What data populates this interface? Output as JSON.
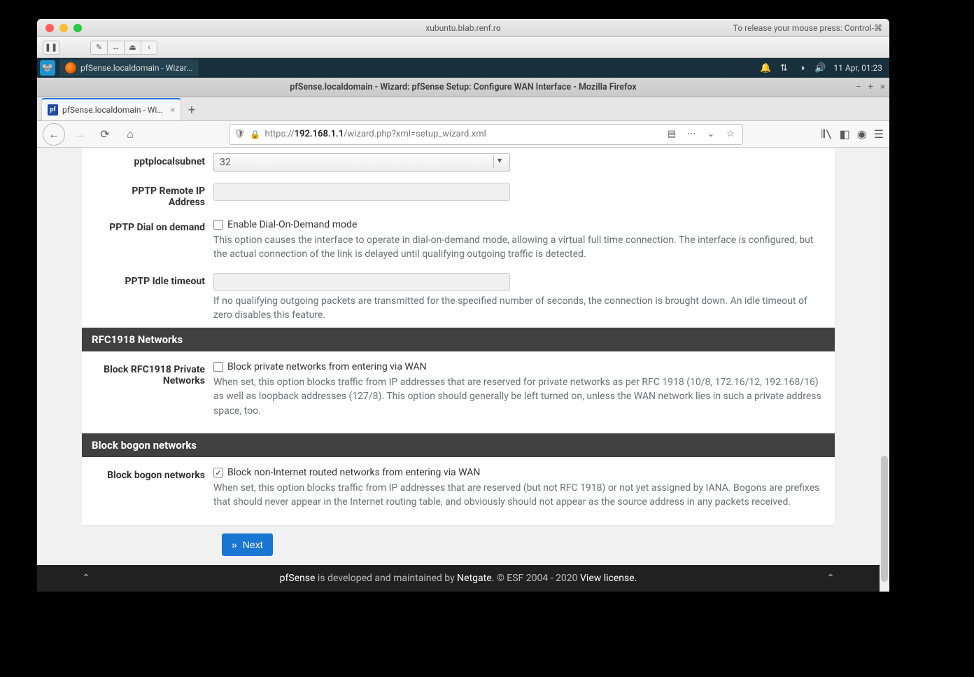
{
  "host": {
    "title": "xubuntu.blab.renf.ro",
    "release_hint": "To release your mouse press: Control-⌘"
  },
  "xfce": {
    "task_label": "pfSense.localdomain - Wizar...",
    "clock": "11 Apr, 01:23"
  },
  "firefox": {
    "window_title": "pfSense.localdomain - Wizard: pfSense Setup: Configure WAN Interface - Mozilla Firefox",
    "tab_label": "pfSense.localdomain - Wizard",
    "url_prefix": "https://",
    "url_host": "192.168.1.1",
    "url_path": "/wizard.php?xml=setup_wizard.xml"
  },
  "form": {
    "pptplocalsubnet": {
      "label": "pptplocalsubnet",
      "value": "32"
    },
    "pptp_remote_ip": {
      "label": "PPTP Remote IP Address",
      "value": ""
    },
    "pptp_dial": {
      "label": "PPTP Dial on demand",
      "checkbox_label": "Enable Dial-On-Demand mode",
      "checked": false,
      "help": "This option causes the interface to operate in dial-on-demand mode, allowing a virtual full time connection. The interface is configured, but the actual connection of the link is delayed until qualifying outgoing traffic is detected."
    },
    "pptp_idle": {
      "label": "PPTP Idle timeout",
      "value": "",
      "help": "If no qualifying outgoing packets are transmitted for the specified number of seconds, the connection is brought down. An idle timeout of zero disables this feature."
    }
  },
  "panels": {
    "rfc1918": {
      "title": "RFC1918 Networks",
      "field_label": "Block RFC1918 Private Networks",
      "checkbox_label": "Block private networks from entering via WAN",
      "checked": false,
      "help": "When set, this option blocks traffic from IP addresses that are reserved for private networks as per RFC 1918 (10/8, 172.16/12, 192.168/16) as well as loopback addresses (127/8). This option should generally be left turned on, unless the WAN network lies in such a private address space, too."
    },
    "bogon": {
      "title": "Block bogon networks",
      "field_label": "Block bogon networks",
      "checkbox_label": "Block non-Internet routed networks from entering via WAN",
      "checked": true,
      "help": "When set, this option blocks traffic from IP addresses that are reserved (but not RFC 1918) or not yet assigned by IANA. Bogons are prefixes that should never appear in the Internet routing table, and obviously should not appear as the source address in any packets received."
    }
  },
  "next_label": "Next",
  "footer": {
    "pfsense": "pfSense",
    "middle": " is developed and maintained by ",
    "netgate": "Netgate.",
    "copyright": " © ESF 2004 - 2020 ",
    "viewlicense": "View license."
  }
}
